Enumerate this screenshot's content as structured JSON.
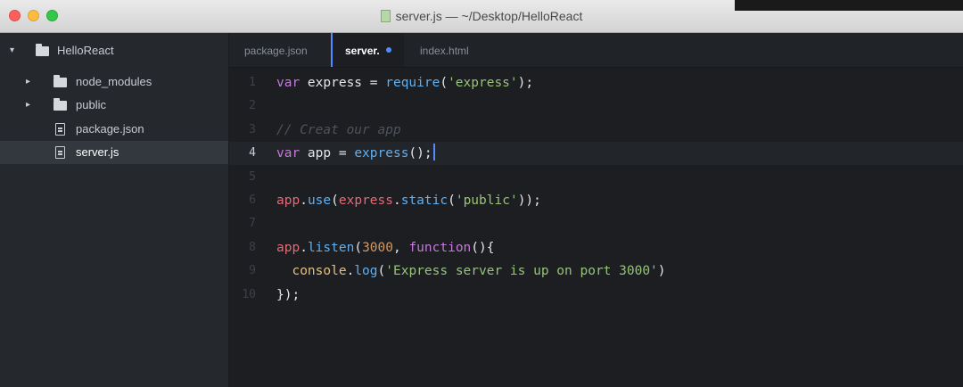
{
  "window": {
    "title": "server.js — ~/Desktop/HelloReact"
  },
  "tree": {
    "root": "HelloReact",
    "items": [
      {
        "label": "node_modules",
        "type": "folder"
      },
      {
        "label": "public",
        "type": "folder"
      },
      {
        "label": "package.json",
        "type": "file"
      },
      {
        "label": "server.js",
        "type": "file",
        "selected": true
      }
    ]
  },
  "tabs": [
    {
      "label": "package.json"
    },
    {
      "label": "server.",
      "active": true,
      "modified": true
    },
    {
      "label": "index.html"
    }
  ],
  "editor": {
    "current_line": 4,
    "lines": [
      {
        "n": "1",
        "tokens": [
          {
            "t": "var",
            "c": "kw"
          },
          {
            "t": " express = "
          },
          {
            "t": "require",
            "c": "fn"
          },
          {
            "t": "("
          },
          {
            "t": "'express'",
            "c": "str"
          },
          {
            "t": ");"
          }
        ]
      },
      {
        "n": "2",
        "tokens": []
      },
      {
        "n": "3",
        "tokens": [
          {
            "t": "// Creat our app",
            "c": "cmt"
          }
        ]
      },
      {
        "n": "4",
        "tokens": [
          {
            "t": "var",
            "c": "kw"
          },
          {
            "t": " app = "
          },
          {
            "t": "express",
            "c": "fn"
          },
          {
            "t": "();"
          }
        ]
      },
      {
        "n": "5",
        "tokens": []
      },
      {
        "n": "6",
        "tokens": [
          {
            "t": "app",
            "c": "var"
          },
          {
            "t": "."
          },
          {
            "t": "use",
            "c": "fn"
          },
          {
            "t": "("
          },
          {
            "t": "express",
            "c": "var"
          },
          {
            "t": "."
          },
          {
            "t": "static",
            "c": "fn"
          },
          {
            "t": "("
          },
          {
            "t": "'public'",
            "c": "str"
          },
          {
            "t": "));"
          }
        ]
      },
      {
        "n": "7",
        "tokens": []
      },
      {
        "n": "8",
        "tokens": [
          {
            "t": "app",
            "c": "var"
          },
          {
            "t": "."
          },
          {
            "t": "listen",
            "c": "fn"
          },
          {
            "t": "("
          },
          {
            "t": "3000",
            "c": "num"
          },
          {
            "t": ", "
          },
          {
            "t": "function",
            "c": "kw"
          },
          {
            "t": "(){"
          }
        ]
      },
      {
        "n": "9",
        "tokens": [
          {
            "t": "  "
          },
          {
            "t": "console",
            "c": "obj"
          },
          {
            "t": "."
          },
          {
            "t": "log",
            "c": "fn"
          },
          {
            "t": "("
          },
          {
            "t": "'Express server is up on port 3000'",
            "c": "str"
          },
          {
            "t": ")"
          }
        ]
      },
      {
        "n": "10",
        "tokens": [
          {
            "t": "});"
          }
        ]
      }
    ]
  },
  "colors": {
    "accent": "#528bff",
    "keyword": "#c678dd",
    "function": "#61afef",
    "string": "#98c379",
    "number": "#d19a66"
  }
}
